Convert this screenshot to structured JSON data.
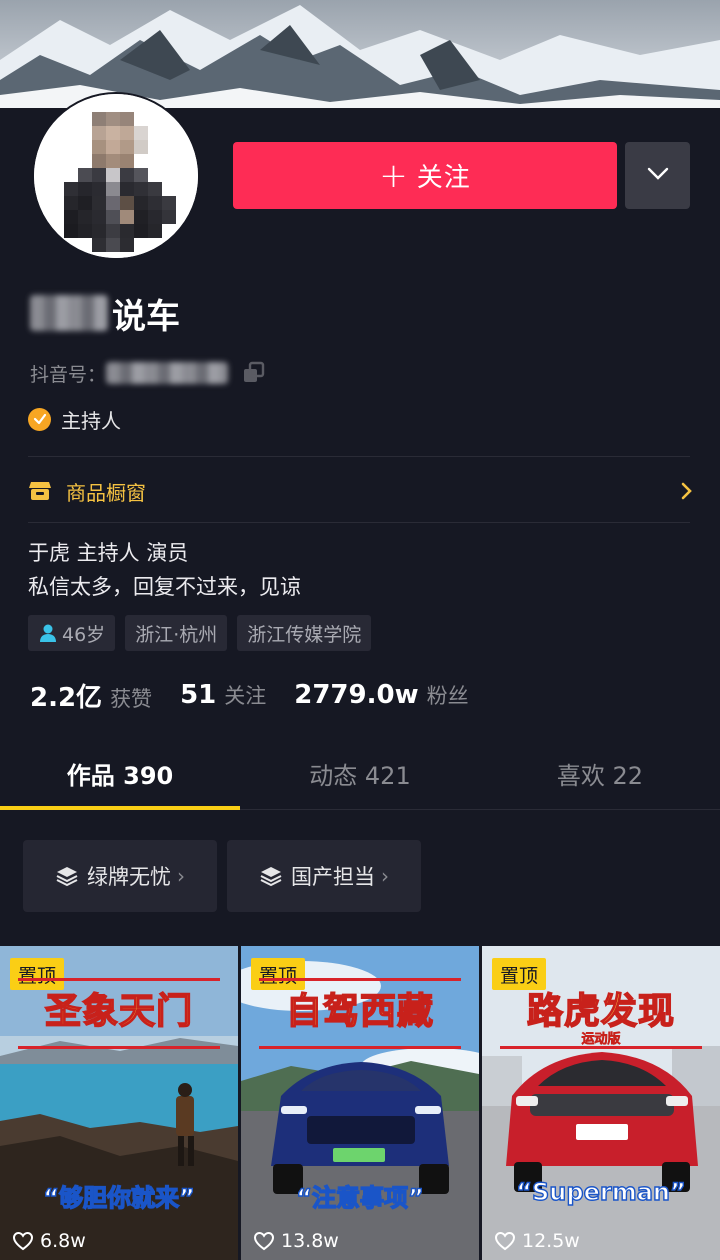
{
  "profile": {
    "name_suffix": "说车",
    "douyin_id_label": "抖音号：",
    "role": "主持人",
    "shop_label": "商品橱窗",
    "bio_line1": "于虎  主持人 演员",
    "bio_line2": "私信太多，回复不过来，见谅",
    "tags": {
      "age": "46岁",
      "location": "浙江·杭州",
      "school": "浙江传媒学院"
    }
  },
  "actions": {
    "follow_label": "关注",
    "follow_plus": "+"
  },
  "stats": {
    "likes_value": "2.2亿",
    "likes_label": "获赞",
    "following_value": "51",
    "following_label": "关注",
    "fans_value": "2779.0w",
    "fans_label": "粉丝"
  },
  "tabs": {
    "works": "作品 390",
    "moments": "动态 421",
    "likes": "喜欢 22"
  },
  "collections": [
    {
      "label": "绿牌无忧"
    },
    {
      "label": "国产担当"
    }
  ],
  "videos": [
    {
      "pin": "置顶",
      "title": "圣象天门",
      "caption": "“够胆你就来”",
      "likes": "6.8w"
    },
    {
      "pin": "置顶",
      "title": "自驾西藏",
      "caption": "“注意事项”",
      "likes": "13.8w"
    },
    {
      "pin": "置顶",
      "title": "路虎发现",
      "subtitle": "运动版",
      "caption": "“Superman”",
      "likes": "12.5w"
    }
  ],
  "colors": {
    "accent": "#fe2c55",
    "background": "#161823",
    "tab_indicator": "#face15",
    "shop": "#f5c242"
  },
  "icons": [
    "chevron-down-icon",
    "copy-icon",
    "check-badge-icon",
    "shop-icon",
    "chevron-right-icon",
    "person-icon",
    "stack-icon",
    "heart-icon"
  ]
}
